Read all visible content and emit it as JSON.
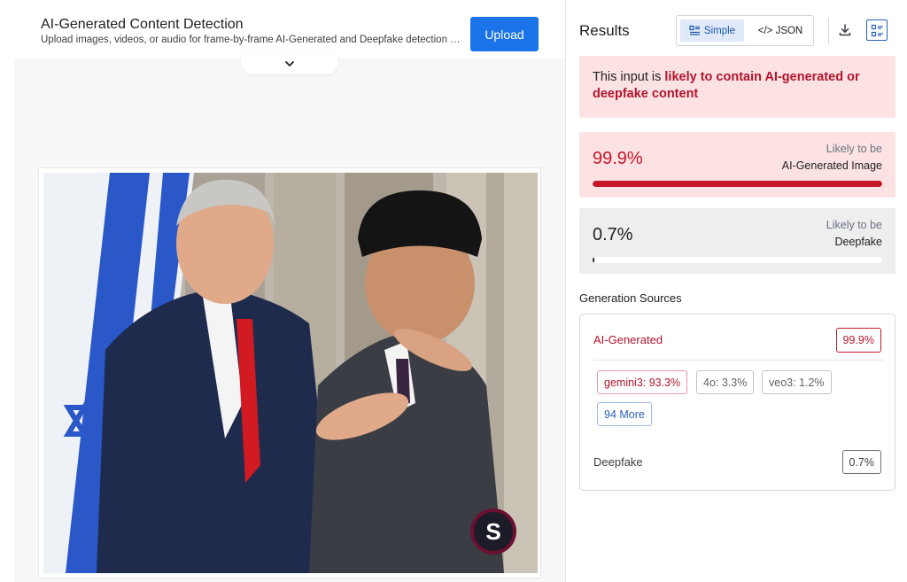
{
  "header": {
    "title": "AI-Generated Content Detection",
    "subtitle": "Upload images, videos, or audio for frame-by-frame AI-Generated and Deepfake detection with...",
    "upload_label": "Upload",
    "expand_icon": "chevron-down-icon"
  },
  "photo": {
    "description_icon": "uploaded-image",
    "watermark_letter": "S"
  },
  "results": {
    "title": "Results",
    "view_toggle": {
      "simple_label": "Simple",
      "json_label": "</> JSON",
      "selected": "Simple"
    },
    "icons": {
      "download": "download-icon",
      "view": "list-view-icon"
    },
    "alert": {
      "prefix": "This input is ",
      "highlight": "likely to contain AI-generated or deepfake content"
    },
    "cards": [
      {
        "percent_text": "99.9%",
        "value": 0.999,
        "label_top": "Likely to be",
        "label_main": "AI-Generated Image"
      },
      {
        "percent_text": "0.7%",
        "value": 0.007,
        "label_top": "Likely to be",
        "label_main": "Deepfake"
      }
    ],
    "generation_sources": {
      "title": "Generation Sources",
      "ai_label": "AI-Generated",
      "ai_value": "99.9%",
      "chips": [
        {
          "text": "gemini3: 93.3%",
          "style": "red"
        },
        {
          "text": "4o: 3.3%",
          "style": "grey"
        },
        {
          "text": "veo3: 1.2%",
          "style": "grey"
        },
        {
          "text": "94 More",
          "style": "blue"
        }
      ],
      "deepfake_label": "Deepfake",
      "deepfake_value": "0.7%"
    }
  },
  "colors": {
    "accent": "#1a73e8",
    "danger": "#c5172a",
    "danger_bg": "#fde2e4",
    "neutral_bg": "#eeeeef"
  }
}
